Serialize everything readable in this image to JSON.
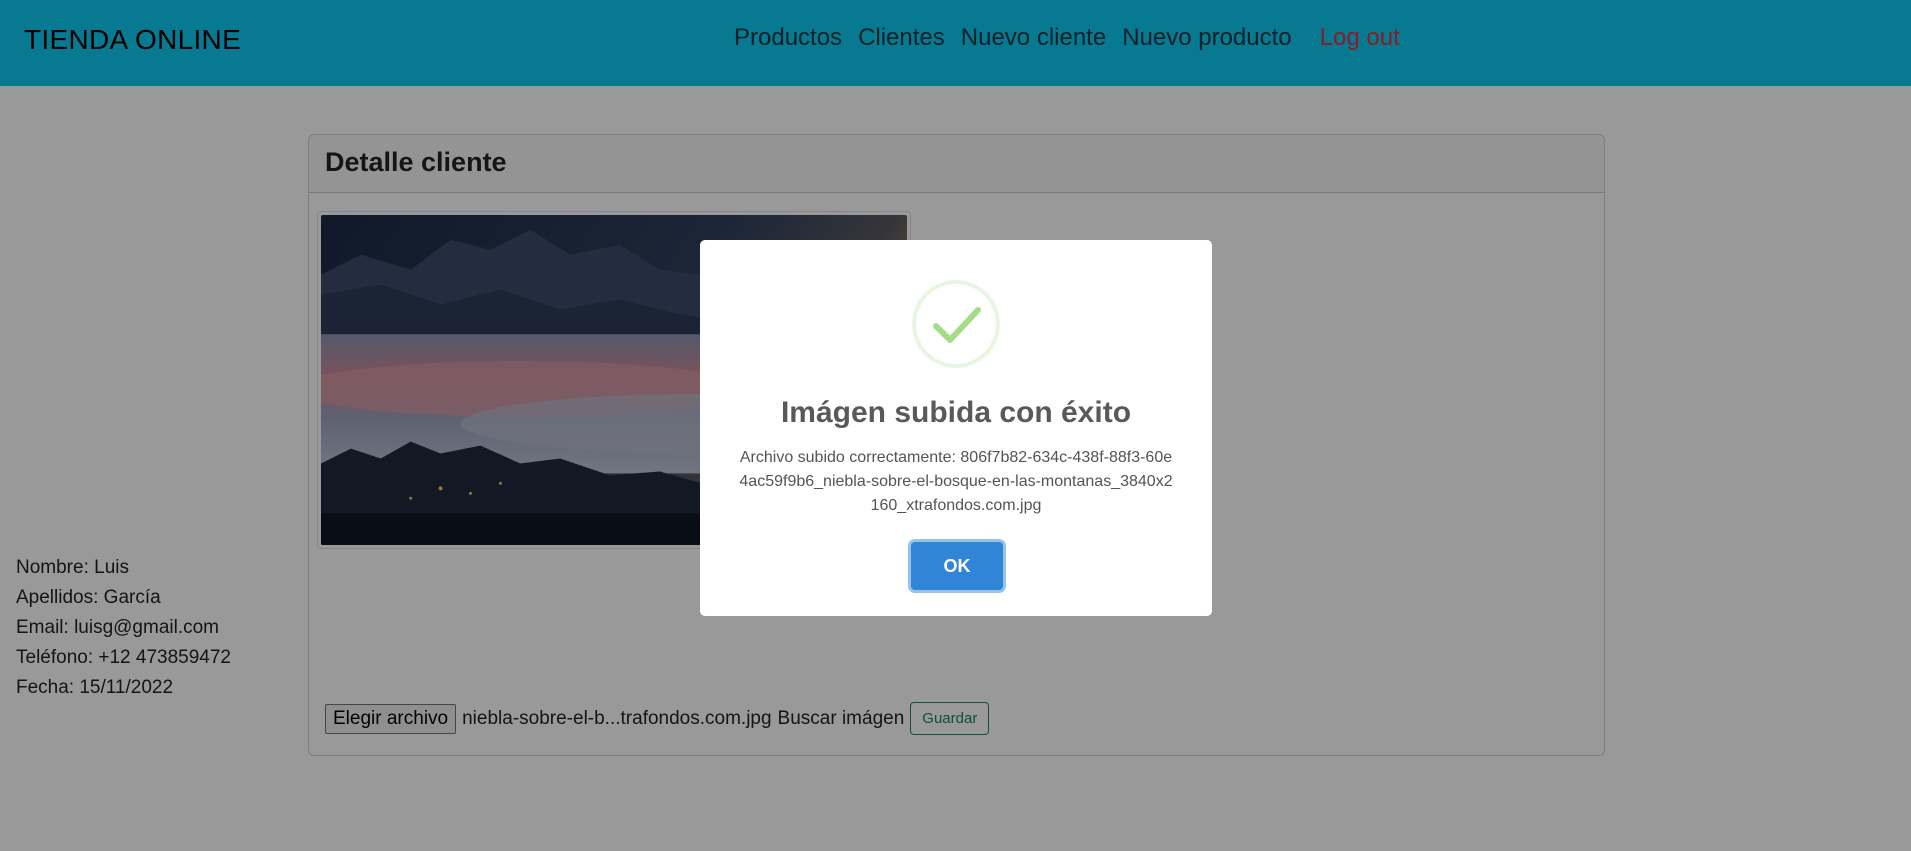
{
  "navbar": {
    "brand": "TIENDA ONLINE",
    "links": [
      {
        "label": "Productos"
      },
      {
        "label": "Clientes"
      },
      {
        "label": "Nuevo cliente"
      },
      {
        "label": "Nuevo producto"
      }
    ],
    "logout": "Log out",
    "bg_color": "#0dcaf0"
  },
  "card": {
    "title": "Detalle cliente",
    "image_icon": "landscape-photo",
    "fields": [
      {
        "text": "Nombre: Luis"
      },
      {
        "text": "Apellidos: García"
      },
      {
        "text": "Email: luisg@gmail.com"
      },
      {
        "text": "Teléfono: +12 473859472"
      },
      {
        "text": "Fecha: 15/11/2022"
      }
    ],
    "upload": {
      "file_button": "Elegir archivo",
      "file_name": "niebla-sobre-el-b...trafondos.com.jpg",
      "label": "Buscar imágen",
      "save_button": "Guardar"
    }
  },
  "modal": {
    "icon": "success-check-icon",
    "title": "Imágen subida con éxito",
    "text": "Archivo subido correctamente: 806f7b82-634c-438f-88f3-60e4ac59f9b6_niebla-sobre-el-bosque-en-las-montanas_3840x2160_xtrafondos.com.jpg",
    "ok_button": "OK",
    "accent_color": "#3085d6",
    "success_color": "#a5dc86"
  }
}
